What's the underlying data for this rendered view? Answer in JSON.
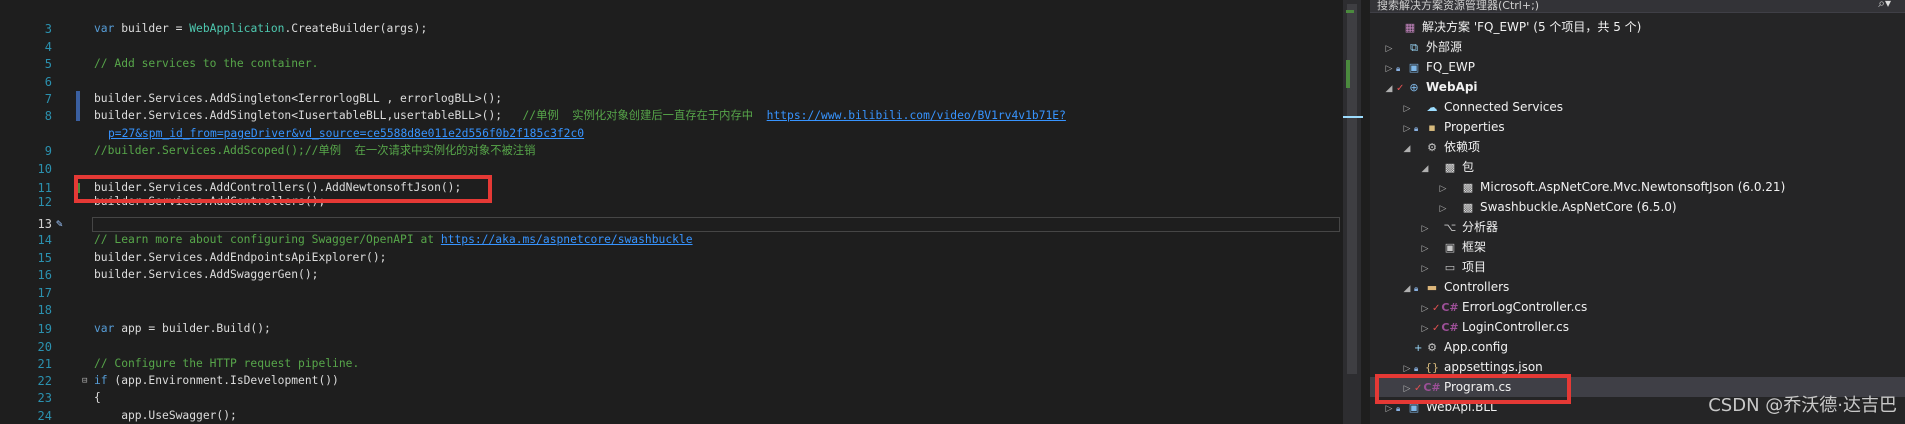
{
  "editor": {
    "line_numbers": [
      "3",
      "4",
      "5",
      "6",
      "7",
      "8",
      "",
      "9",
      "10",
      "11",
      "12",
      "13",
      "14",
      "15",
      "16",
      "17",
      "18",
      "19",
      "20",
      "21",
      "22",
      "23",
      "24"
    ],
    "lines": {
      "l3_a": "var",
      "l3_b": " builder = ",
      "l3_c": "WebApplication",
      "l3_d": ".CreateBuilder(args);",
      "l5": "// Add services to the container.",
      "l7": "builder.Services.AddSingleton<IerrorlogBLL , errorlogBLL>();",
      "l8_code": "builder.Services.AddSingleton<IusertableBLL,usertableBLL>();   ",
      "l8_comment": "//单例  实例化对象创建后一直存在于内存中  ",
      "l8_link": "https://www.bilibili.com/video/BV1rv4v1b71E?",
      "l8_wrap": "p=27&spm_id_from=pageDriver&vd_source=ce5588d8e011e2d556f0b2f185c3f2c0",
      "l9": "//builder.Services.AddScoped();//单例  在一次请求中实例化的对象不被注销",
      "l11": "builder.Services.AddControllers().AddNewtonsoftJson();",
      "l12": "builder.Services.AddControllers();",
      "l14_comment": "// Learn more about configuring Swagger/OpenAPI at ",
      "l14_link": "https://aka.ms/aspnetcore/swashbuckle",
      "l15": "builder.Services.AddEndpointsApiExplorer();",
      "l16": "builder.Services.AddSwaggerGen();",
      "l19_a": "var",
      "l19_b": " app = builder.Build();",
      "l21": "// Configure the HTTP request pipeline.",
      "l22_a": "if",
      "l22_b": " (app.Environment.IsDevelopment())",
      "l23": "{",
      "l24": "    app.UseSwagger();"
    }
  },
  "explorer": {
    "search_placeholder": "搜索解决方案资源管理器(Ctrl+;)",
    "items": [
      {
        "label": "解决方案 'FQ_EWP' (5 个项目，共 5 个)",
        "icon": "solution-icon"
      },
      {
        "label": "外部源",
        "icon": "external-sources-icon"
      },
      {
        "label": "FQ_EWP",
        "icon": "project-icon"
      },
      {
        "label": "WebApi",
        "icon": "web-project-icon"
      },
      {
        "label": "Connected Services",
        "icon": "connected-services-icon"
      },
      {
        "label": "Properties",
        "icon": "properties-icon"
      },
      {
        "label": "依赖项",
        "icon": "dependencies-icon"
      },
      {
        "label": "包",
        "icon": "packages-icon"
      },
      {
        "label": "Microsoft.AspNetCore.Mvc.NewtonsoftJson (6.0.21)",
        "icon": "package-icon"
      },
      {
        "label": "Swashbuckle.AspNetCore (6.5.0)",
        "icon": "package-icon"
      },
      {
        "label": "分析器",
        "icon": "analyzers-icon"
      },
      {
        "label": "框架",
        "icon": "frameworks-icon"
      },
      {
        "label": "项目",
        "icon": "projects-icon"
      },
      {
        "label": "Controllers",
        "icon": "folder-icon"
      },
      {
        "label": "ErrorLogController.cs",
        "icon": "csharp-file-icon"
      },
      {
        "label": "LoginController.cs",
        "icon": "csharp-file-icon"
      },
      {
        "label": "App.config",
        "icon": "config-icon"
      },
      {
        "label": "appsettings.json",
        "icon": "json-file-icon"
      },
      {
        "label": "Program.cs",
        "icon": "csharp-file-icon"
      },
      {
        "label": "WebApi.BLL",
        "icon": "project-icon"
      }
    ],
    "cs_badge": "C#"
  },
  "watermark": "CSDN @乔沃德·达吉巴",
  "colors": {
    "highlight_box": "#e53935",
    "editor_bg": "#1e1e1e",
    "explorer_bg": "#252526"
  }
}
